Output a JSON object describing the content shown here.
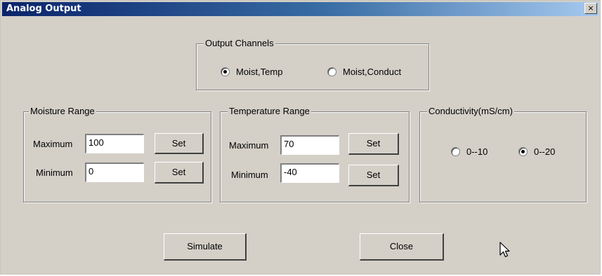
{
  "window": {
    "title": "Analog Output",
    "close_label": "×"
  },
  "output_channels": {
    "legend": "Output Channels",
    "options": [
      {
        "label": "Moist,Temp",
        "selected": true
      },
      {
        "label": "Moist,Conduct",
        "selected": false
      }
    ]
  },
  "moisture_range": {
    "legend": "Moisture Range",
    "max_label": "Maximum",
    "max_value": "100",
    "min_label": "Minimum",
    "min_value": "0",
    "set_label": "Set"
  },
  "temperature_range": {
    "legend": "Temperature Range",
    "max_label": "Maximum",
    "max_value": "70",
    "min_label": "Minimum",
    "min_value": "-40",
    "set_label": "Set"
  },
  "conductivity": {
    "legend": "Conductivity(mS/cm)",
    "options": [
      {
        "label": "0--10",
        "selected": false
      },
      {
        "label": "0--20",
        "selected": true
      }
    ]
  },
  "buttons": {
    "simulate": "Simulate",
    "close": "Close"
  },
  "icons": {
    "cursor": "mouse-pointer-icon"
  }
}
